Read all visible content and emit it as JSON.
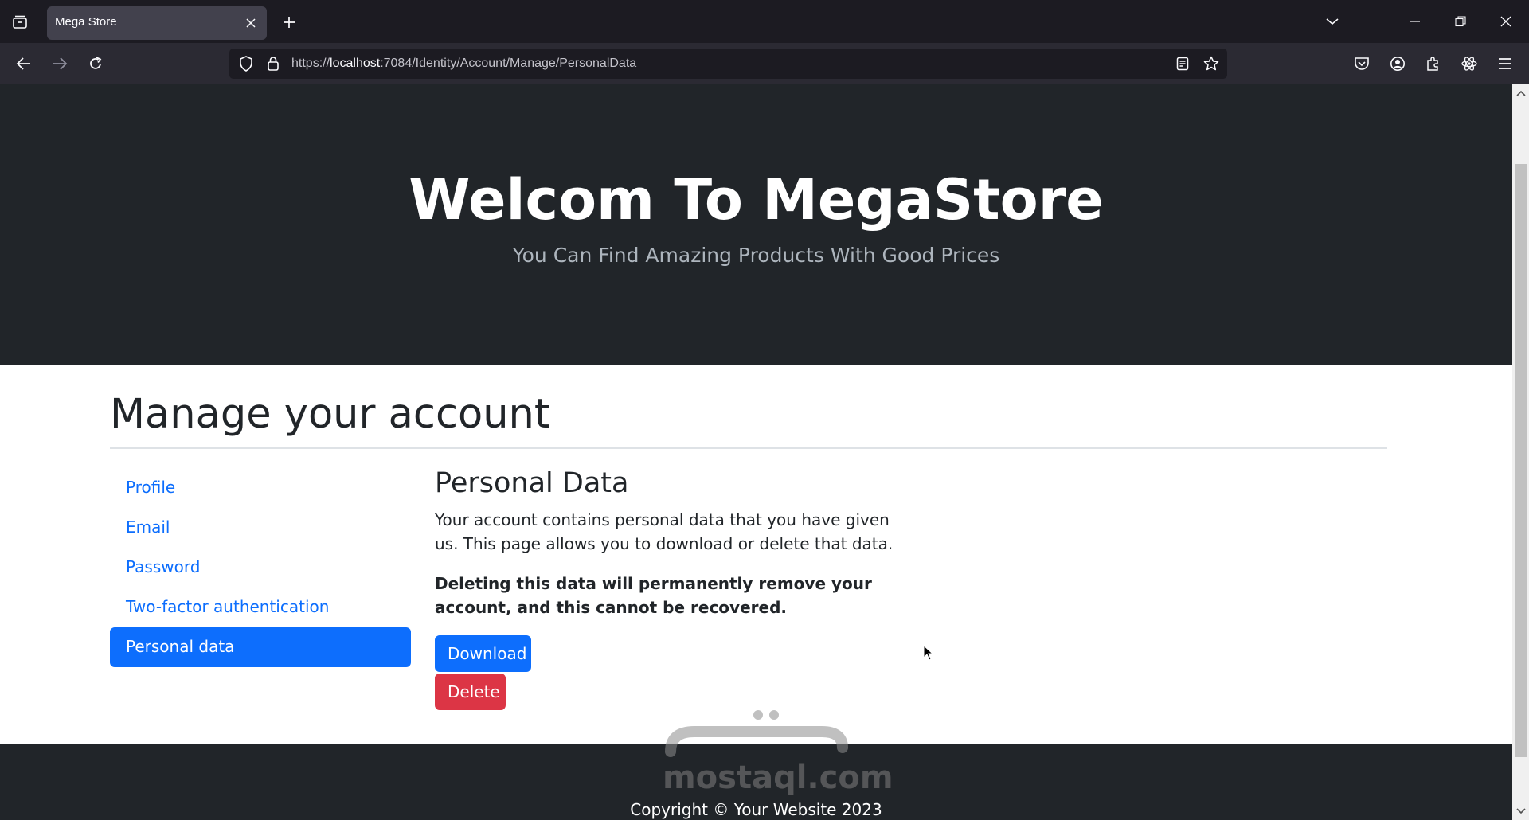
{
  "browser": {
    "tab_title": "Mega Store",
    "url_prefix": "https://",
    "url_host": "localhost",
    "url_rest": ":7084/Identity/Account/Manage/PersonalData"
  },
  "hero": {
    "title": "Welcom To MegaStore",
    "subtitle": "You Can Find Amazing Products With Good Prices"
  },
  "manage": {
    "title": "Manage your account",
    "nav": [
      {
        "label": "Profile",
        "active": false
      },
      {
        "label": "Email",
        "active": false
      },
      {
        "label": "Password",
        "active": false
      },
      {
        "label": "Two-factor authentication",
        "active": false
      },
      {
        "label": "Personal data",
        "active": true
      }
    ]
  },
  "personal_data": {
    "heading": "Personal Data",
    "description": "Your account contains personal data that you have given us. This page allows you to download or delete that data.",
    "warning": "Deleting this data will permanently remove your account, and this cannot be recovered.",
    "download_label": "Download",
    "delete_label": "Delete"
  },
  "footer": {
    "copyright": "Copyright © Your Website 2023"
  },
  "watermark": {
    "text": "mostaql.com"
  },
  "colors": {
    "primary": "#0d6efd",
    "danger": "#dc3545",
    "dark": "#212529"
  }
}
